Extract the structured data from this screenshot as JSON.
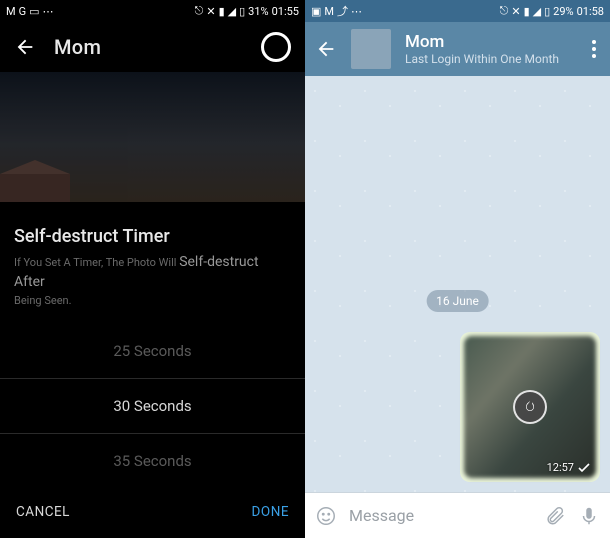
{
  "left": {
    "status": {
      "icons_left": [
        "gmail",
        "google",
        "briefcase",
        "ellipsis"
      ],
      "icons_right": [
        "location",
        "vibrate",
        "wifi-off",
        "signal",
        "battery"
      ],
      "battery_pct": "31%",
      "time": "01:55"
    },
    "header": {
      "title": "Mom"
    },
    "sheet": {
      "title": "Self-destruct Timer",
      "sub_line1": "If You Set A Timer, The Photo Will",
      "sub_em": "Self-destruct After",
      "sub_line2": "Being Seen.",
      "options": [
        "25 Seconds",
        "30 Seconds",
        "35 Seconds"
      ],
      "selected_index": 1,
      "cancel": "CANCEL",
      "done": "DONE"
    }
  },
  "right": {
    "status": {
      "icons_left": [
        "image",
        "gmail",
        "send",
        "ellipsis"
      ],
      "icons_right": [
        "location",
        "vibrate",
        "wifi-off",
        "signal",
        "battery"
      ],
      "battery_pct": "29%",
      "time": "01:58"
    },
    "header": {
      "name": "Mom",
      "sub": "Last Login Within One Month"
    },
    "chat": {
      "date": "16 June",
      "message_time": "12:57"
    },
    "input": {
      "placeholder": "Message"
    }
  },
  "colors": {
    "telegram_header": "#5a87a6",
    "bubble_out": "#e9f3d9"
  }
}
